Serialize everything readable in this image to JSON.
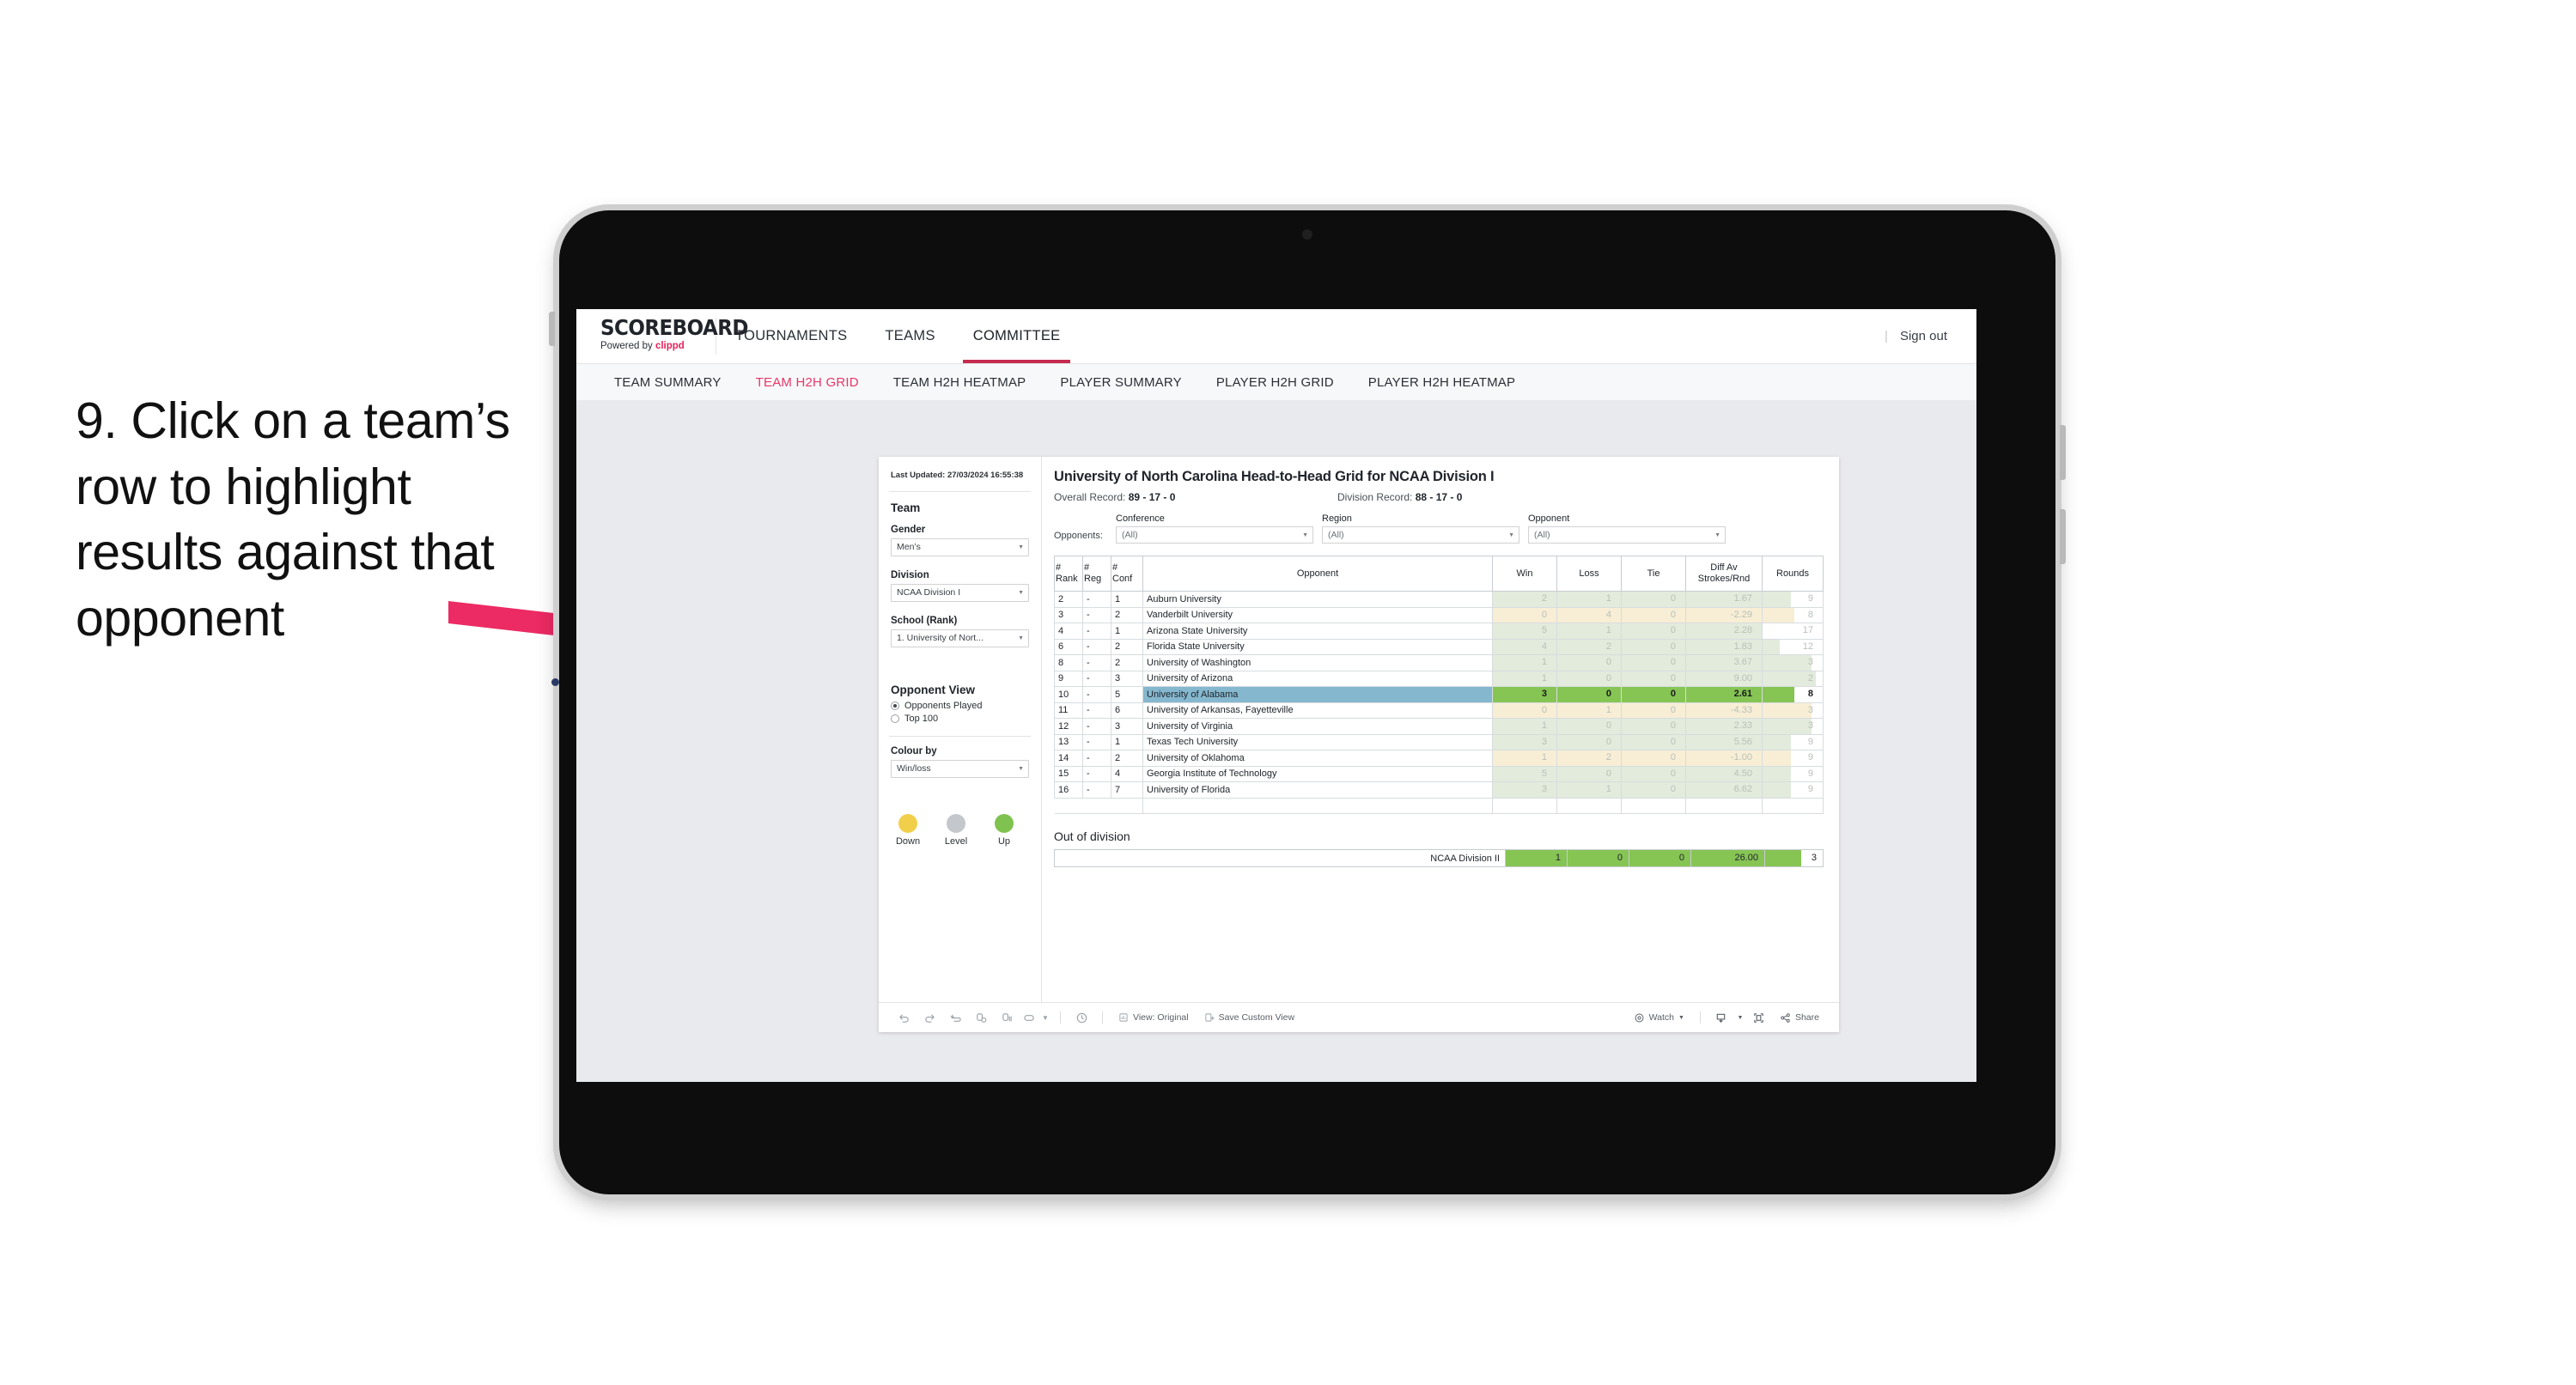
{
  "callout": {
    "text": "9. Click on a team’s row to highlight results against that opponent"
  },
  "app": {
    "brand_title": "SCOREBOARD",
    "brand_sub_prefix": "Powered by ",
    "brand_sub_name": "clippd",
    "accent_pink": "#e8215a",
    "nav": [
      {
        "label": "TOURNAMENTS",
        "active": false
      },
      {
        "label": "TEAMS",
        "active": false
      },
      {
        "label": "COMMITTEE",
        "active": true
      }
    ],
    "sign_out": "Sign out",
    "sign_out_divider": "|",
    "subnav": [
      {
        "label": "TEAM SUMMARY",
        "active": false
      },
      {
        "label": "TEAM H2H GRID",
        "active": true
      },
      {
        "label": "TEAM H2H HEATMAP",
        "active": false
      },
      {
        "label": "PLAYER SUMMARY",
        "active": false
      },
      {
        "label": "PLAYER H2H GRID",
        "active": false
      },
      {
        "label": "PLAYER H2H HEATMAP",
        "active": false
      }
    ]
  },
  "panel": {
    "last_updated_label": "Last Updated: ",
    "last_updated_value": "27/03/2024 16:55:38",
    "team_heading": "Team",
    "gender_label": "Gender",
    "gender_value": "Men’s",
    "division_label": "Division",
    "division_value": "NCAA Division I",
    "school_label": "School (Rank)",
    "school_value": "1. University of Nort...",
    "opponent_view_heading": "Opponent View",
    "opponent_view_options": [
      {
        "label": "Opponents Played",
        "selected": true
      },
      {
        "label": "Top 100",
        "selected": false
      }
    ],
    "colour_by_label": "Colour by",
    "colour_by_value": "Win/loss",
    "legend": [
      {
        "caption": "Down",
        "color": "#f2cf4a"
      },
      {
        "caption": "Level",
        "color": "#c4c7cb"
      },
      {
        "caption": "Up",
        "color": "#80c24f"
      }
    ]
  },
  "viz": {
    "title": "University of North Carolina Head-to-Head Grid for NCAA Division I",
    "overall_record_label": "Overall Record: ",
    "overall_record_value": "89 - 17 - 0",
    "division_record_label": "Division Record: ",
    "division_record_value": "88 - 17 - 0",
    "opponents_label": "Opponents:",
    "filters": [
      {
        "caption": "Conference",
        "value": "(All)"
      },
      {
        "caption": "Region",
        "value": "(All)"
      },
      {
        "caption": "Opponent",
        "value": "(All)"
      }
    ]
  },
  "table": {
    "headers": {
      "rank": "#\nRank",
      "rank_l1": "#",
      "rank_l2": "Rank",
      "reg_l1": "#",
      "reg_l2": "Reg",
      "conf_l1": "#",
      "conf_l2": "Conf",
      "opponent": "Opponent",
      "win": "Win",
      "loss": "Loss",
      "tie": "Tie",
      "diff_l1": "Diff Av",
      "diff_l2": "Strokes/Rnd",
      "rounds": "Rounds"
    },
    "rows": [
      {
        "rank": "2",
        "reg": "-",
        "conf": "1",
        "opponent": "Auburn University",
        "win": "2",
        "loss": "1",
        "tie": "0",
        "diff": "1.67",
        "rounds": "9",
        "state": "up",
        "highlight": false
      },
      {
        "rank": "3",
        "reg": "-",
        "conf": "2",
        "opponent": "Vanderbilt University",
        "win": "0",
        "loss": "4",
        "tie": "0",
        "diff": "-2.29",
        "rounds": "8",
        "state": "down",
        "highlight": false
      },
      {
        "rank": "4",
        "reg": "-",
        "conf": "1",
        "opponent": "Arizona State University",
        "win": "5",
        "loss": "1",
        "tie": "0",
        "diff": "2.28",
        "rounds": "17",
        "state": "up",
        "highlight": false
      },
      {
        "rank": "6",
        "reg": "-",
        "conf": "2",
        "opponent": "Florida State University",
        "win": "4",
        "loss": "2",
        "tie": "0",
        "diff": "1.83",
        "rounds": "12",
        "state": "up",
        "highlight": false
      },
      {
        "rank": "8",
        "reg": "-",
        "conf": "2",
        "opponent": "University of Washington",
        "win": "1",
        "loss": "0",
        "tie": "0",
        "diff": "3.67",
        "rounds": "3",
        "state": "up",
        "highlight": false
      },
      {
        "rank": "9",
        "reg": "-",
        "conf": "3",
        "opponent": "University of Arizona",
        "win": "1",
        "loss": "0",
        "tie": "0",
        "diff": "9.00",
        "rounds": "2",
        "state": "up",
        "highlight": false
      },
      {
        "rank": "10",
        "reg": "-",
        "conf": "5",
        "opponent": "University of Alabama",
        "win": "3",
        "loss": "0",
        "tie": "0",
        "diff": "2.61",
        "rounds": "8",
        "state": "up",
        "highlight": true
      },
      {
        "rank": "11",
        "reg": "-",
        "conf": "6",
        "opponent": "University of Arkansas, Fayetteville",
        "win": "0",
        "loss": "1",
        "tie": "0",
        "diff": "-4.33",
        "rounds": "3",
        "state": "down",
        "highlight": false
      },
      {
        "rank": "12",
        "reg": "-",
        "conf": "3",
        "opponent": "University of Virginia",
        "win": "1",
        "loss": "0",
        "tie": "0",
        "diff": "2.33",
        "rounds": "3",
        "state": "up",
        "highlight": false
      },
      {
        "rank": "13",
        "reg": "-",
        "conf": "1",
        "opponent": "Texas Tech University",
        "win": "3",
        "loss": "0",
        "tie": "0",
        "diff": "5.56",
        "rounds": "9",
        "state": "up",
        "highlight": false
      },
      {
        "rank": "14",
        "reg": "-",
        "conf": "2",
        "opponent": "University of Oklahoma",
        "win": "1",
        "loss": "2",
        "tie": "0",
        "diff": "-1.00",
        "rounds": "9",
        "state": "down",
        "highlight": false
      },
      {
        "rank": "15",
        "reg": "-",
        "conf": "4",
        "opponent": "Georgia Institute of Technology",
        "win": "5",
        "loss": "0",
        "tie": "0",
        "diff": "4.50",
        "rounds": "9",
        "state": "up",
        "highlight": false
      },
      {
        "rank": "16",
        "reg": "-",
        "conf": "7",
        "opponent": "University of Florida",
        "win": "3",
        "loss": "1",
        "tie": "0",
        "diff": "6.62",
        "rounds": "9",
        "state": "up",
        "highlight": false
      }
    ]
  },
  "out_of_division": {
    "title": "Out of division",
    "row": {
      "label": "NCAA Division II",
      "win": "1",
      "loss": "0",
      "tie": "0",
      "diff": "26.00",
      "rounds": "3"
    }
  },
  "toolbar": {
    "view_original": "View: Original",
    "save_custom_view": "Save Custom View",
    "watch": "Watch",
    "share": "Share"
  },
  "chart_data": {
    "type": "table",
    "title": "University of North Carolina Head-to-Head Grid for NCAA Division I",
    "columns": [
      "# Rank",
      "# Reg",
      "# Conf",
      "Opponent",
      "Win",
      "Loss",
      "Tie",
      "Diff Av Strokes/Rnd",
      "Rounds"
    ],
    "rows": [
      [
        "2",
        "-",
        "1",
        "Auburn University",
        2,
        1,
        0,
        1.67,
        9
      ],
      [
        "3",
        "-",
        "2",
        "Vanderbilt University",
        0,
        4,
        0,
        -2.29,
        8
      ],
      [
        "4",
        "-",
        "1",
        "Arizona State University",
        5,
        1,
        0,
        2.28,
        17
      ],
      [
        "6",
        "-",
        "2",
        "Florida State University",
        4,
        2,
        0,
        1.83,
        12
      ],
      [
        "8",
        "-",
        "2",
        "University of Washington",
        1,
        0,
        0,
        3.67,
        3
      ],
      [
        "9",
        "-",
        "3",
        "University of Arizona",
        1,
        0,
        0,
        9.0,
        2
      ],
      [
        "10",
        "-",
        "5",
        "University of Alabama",
        3,
        0,
        0,
        2.61,
        8
      ],
      [
        "11",
        "-",
        "6",
        "University of Arkansas, Fayetteville",
        0,
        1,
        0,
        -4.33,
        3
      ],
      [
        "12",
        "-",
        "3",
        "University of Virginia",
        1,
        0,
        0,
        2.33,
        3
      ],
      [
        "13",
        "-",
        "1",
        "Texas Tech University",
        3,
        0,
        0,
        5.56,
        9
      ],
      [
        "14",
        "-",
        "2",
        "University of Oklahoma",
        1,
        2,
        0,
        -1.0,
        9
      ],
      [
        "15",
        "-",
        "4",
        "Georgia Institute of Technology",
        5,
        0,
        0,
        4.5,
        9
      ],
      [
        "16",
        "-",
        "7",
        "University of Florida",
        3,
        1,
        0,
        6.62,
        9
      ]
    ],
    "out_of_division": [
      [
        "NCAA Division II",
        1,
        0,
        0,
        26.0,
        3
      ]
    ],
    "highlighted_row": "University of Alabama",
    "colour_encoding": "Win/loss",
    "legend": [
      {
        "label": "Down",
        "color": "#f2cf4a"
      },
      {
        "label": "Level",
        "color": "#c4c7cb"
      },
      {
        "label": "Up",
        "color": "#80c24f"
      }
    ]
  }
}
